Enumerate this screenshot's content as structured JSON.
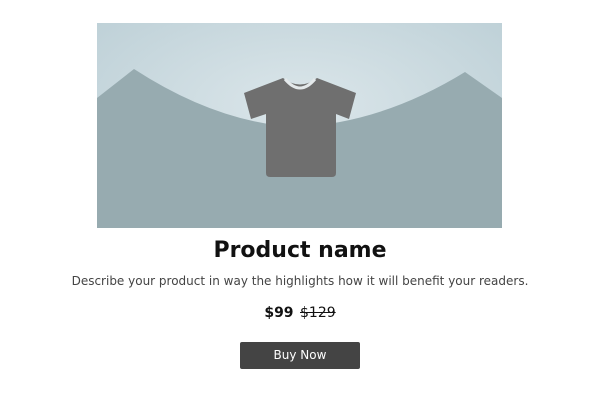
{
  "product": {
    "title": "Product name",
    "description": "Describe your product in way the highlights how it will benefit your readers.",
    "price_current": "$99",
    "price_original": "$129",
    "cta_label": "Buy Now",
    "image_icon": "tshirt-icon"
  },
  "colors": {
    "sky": "#c9d9e0",
    "hills": "#97abb0",
    "icon": "#6f6f6f",
    "button": "#444444",
    "button_text": "#ffffff"
  }
}
